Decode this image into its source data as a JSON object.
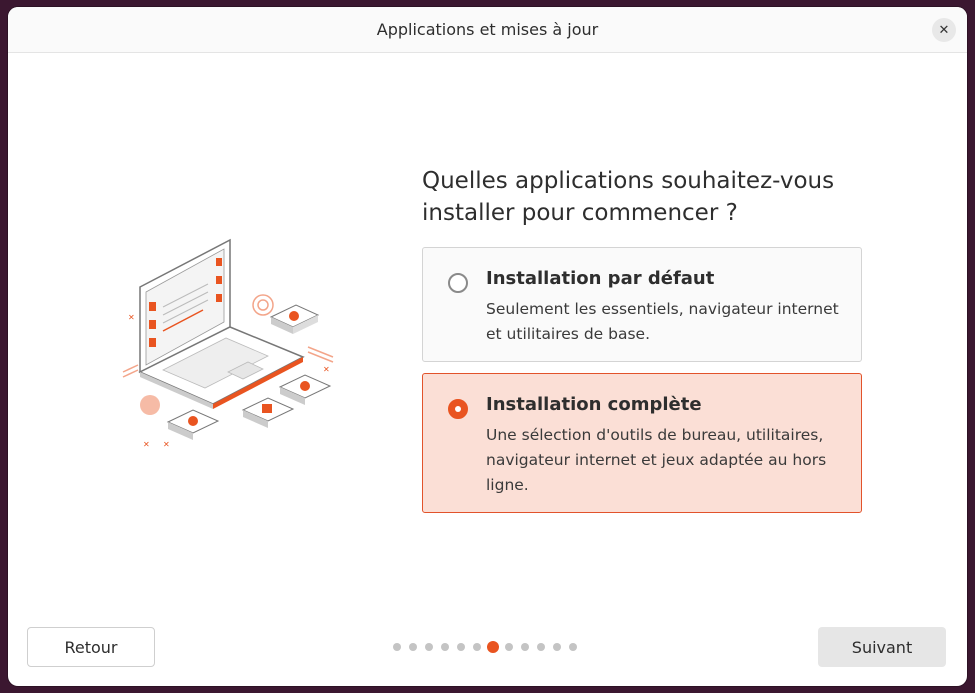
{
  "window": {
    "title": "Applications et mises à jour"
  },
  "question": {
    "line1": "Quelles applications souhaitez-vous",
    "line2": "installer pour commencer ?"
  },
  "options": [
    {
      "title": "Installation par défaut",
      "description": "Seulement les essentiels, navigateur internet et utilitaires de base.",
      "selected": false
    },
    {
      "title": "Installation complète",
      "description": "Une sélection d'outils de bureau, utilitaires, navigateur internet et jeux adaptée au hors ligne.",
      "selected": true
    }
  ],
  "buttons": {
    "back": "Retour",
    "next": "Suivant"
  },
  "pagination": {
    "total": 12,
    "current": 7
  },
  "colors": {
    "accent": "#e95420",
    "selected_bg": "#fbdfd6",
    "window_bg": "#ffffff",
    "desktop_bg": "#3b1730"
  },
  "icons": {
    "close": "close-icon",
    "illustration": "laptop-apps-illustration"
  }
}
